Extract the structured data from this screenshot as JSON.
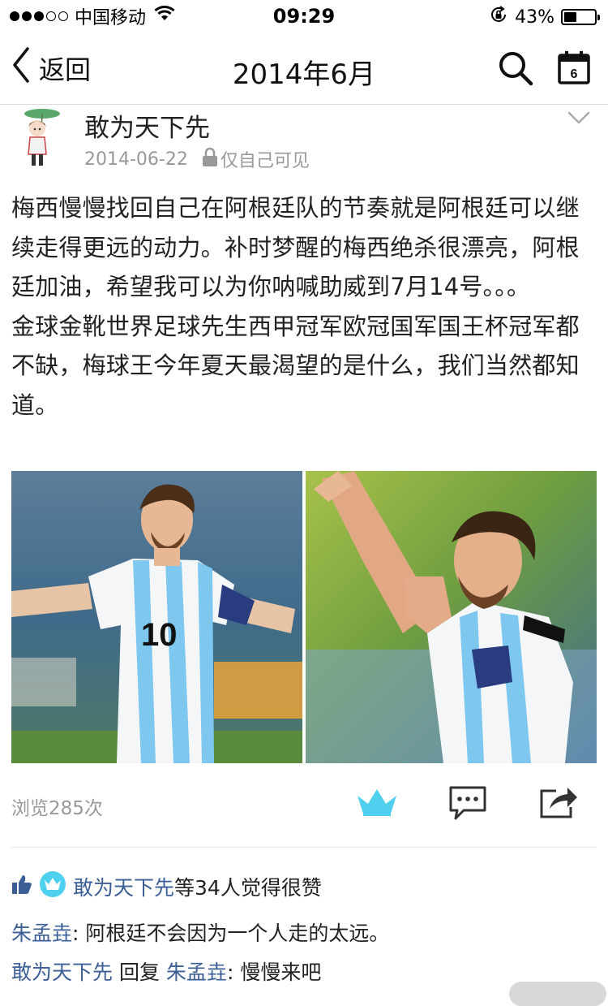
{
  "status_bar": {
    "signal_dots_filled": 3,
    "signal_dots_total": 5,
    "carrier": "中国移动",
    "time": "09:29",
    "battery_percent": "43%",
    "battery_level": 0.43
  },
  "nav": {
    "back_label": "返回",
    "title": "2014年6月",
    "calendar_day": "6"
  },
  "post": {
    "author": "敢为天下先",
    "date": "2014-06-22",
    "visibility": "仅自己可见",
    "paragraphs": [
      "梅西慢慢找回自己在阿根廷队的节奏就是阿根廷可以继续走得更远的动力。补时梦醒的梅西绝杀很漂亮，阿根廷加油，希望我可以为你呐喊助威到7月14号。。。",
      "金球金靴世界足球先生西甲冠军欧冠国军国王杯冠军都不缺，梅球王今年夏天最渴望的是什么，我们当然都知道。"
    ],
    "jersey_number": "10",
    "views": "浏览285次"
  },
  "likes": {
    "names": "敢为天下先",
    "suffix": "等34人觉得很赞"
  },
  "comments": [
    {
      "author": "朱孟垚",
      "sep": ": ",
      "text": "阿根廷不会因为一个人走的太远。"
    },
    {
      "author": "敢为天下先",
      "reply_word": " 回复 ",
      "reply_to": "朱孟垚",
      "sep": ": ",
      "text": "慢慢来吧"
    }
  ],
  "colors": {
    "link_blue": "#3b5e96",
    "crown_cyan": "#4fd0ee",
    "meta_gray": "#999999"
  }
}
